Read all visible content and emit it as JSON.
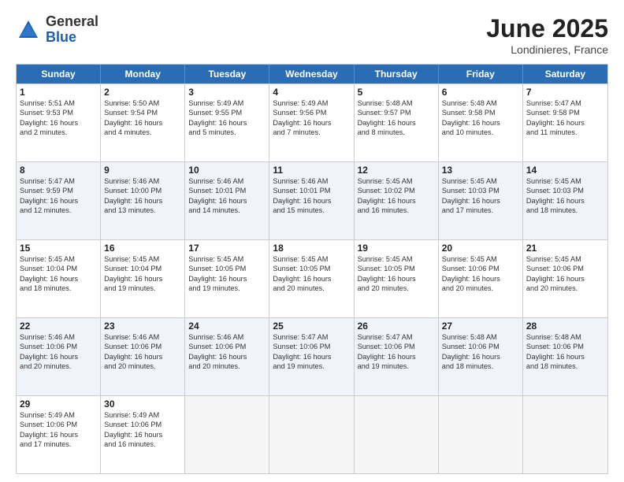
{
  "header": {
    "logo_general": "General",
    "logo_blue": "Blue",
    "title": "June 2025",
    "location": "Londinieres, France"
  },
  "days_of_week": [
    "Sunday",
    "Monday",
    "Tuesday",
    "Wednesday",
    "Thursday",
    "Friday",
    "Saturday"
  ],
  "rows": [
    [
      {
        "day": "1",
        "lines": [
          "Sunrise: 5:51 AM",
          "Sunset: 9:53 PM",
          "Daylight: 16 hours",
          "and 2 minutes."
        ]
      },
      {
        "day": "2",
        "lines": [
          "Sunrise: 5:50 AM",
          "Sunset: 9:54 PM",
          "Daylight: 16 hours",
          "and 4 minutes."
        ]
      },
      {
        "day": "3",
        "lines": [
          "Sunrise: 5:49 AM",
          "Sunset: 9:55 PM",
          "Daylight: 16 hours",
          "and 5 minutes."
        ]
      },
      {
        "day": "4",
        "lines": [
          "Sunrise: 5:49 AM",
          "Sunset: 9:56 PM",
          "Daylight: 16 hours",
          "and 7 minutes."
        ]
      },
      {
        "day": "5",
        "lines": [
          "Sunrise: 5:48 AM",
          "Sunset: 9:57 PM",
          "Daylight: 16 hours",
          "and 8 minutes."
        ]
      },
      {
        "day": "6",
        "lines": [
          "Sunrise: 5:48 AM",
          "Sunset: 9:58 PM",
          "Daylight: 16 hours",
          "and 10 minutes."
        ]
      },
      {
        "day": "7",
        "lines": [
          "Sunrise: 5:47 AM",
          "Sunset: 9:58 PM",
          "Daylight: 16 hours",
          "and 11 minutes."
        ]
      }
    ],
    [
      {
        "day": "8",
        "lines": [
          "Sunrise: 5:47 AM",
          "Sunset: 9:59 PM",
          "Daylight: 16 hours",
          "and 12 minutes."
        ]
      },
      {
        "day": "9",
        "lines": [
          "Sunrise: 5:46 AM",
          "Sunset: 10:00 PM",
          "Daylight: 16 hours",
          "and 13 minutes."
        ]
      },
      {
        "day": "10",
        "lines": [
          "Sunrise: 5:46 AM",
          "Sunset: 10:01 PM",
          "Daylight: 16 hours",
          "and 14 minutes."
        ]
      },
      {
        "day": "11",
        "lines": [
          "Sunrise: 5:46 AM",
          "Sunset: 10:01 PM",
          "Daylight: 16 hours",
          "and 15 minutes."
        ]
      },
      {
        "day": "12",
        "lines": [
          "Sunrise: 5:45 AM",
          "Sunset: 10:02 PM",
          "Daylight: 16 hours",
          "and 16 minutes."
        ]
      },
      {
        "day": "13",
        "lines": [
          "Sunrise: 5:45 AM",
          "Sunset: 10:03 PM",
          "Daylight: 16 hours",
          "and 17 minutes."
        ]
      },
      {
        "day": "14",
        "lines": [
          "Sunrise: 5:45 AM",
          "Sunset: 10:03 PM",
          "Daylight: 16 hours",
          "and 18 minutes."
        ]
      }
    ],
    [
      {
        "day": "15",
        "lines": [
          "Sunrise: 5:45 AM",
          "Sunset: 10:04 PM",
          "Daylight: 16 hours",
          "and 18 minutes."
        ]
      },
      {
        "day": "16",
        "lines": [
          "Sunrise: 5:45 AM",
          "Sunset: 10:04 PM",
          "Daylight: 16 hours",
          "and 19 minutes."
        ]
      },
      {
        "day": "17",
        "lines": [
          "Sunrise: 5:45 AM",
          "Sunset: 10:05 PM",
          "Daylight: 16 hours",
          "and 19 minutes."
        ]
      },
      {
        "day": "18",
        "lines": [
          "Sunrise: 5:45 AM",
          "Sunset: 10:05 PM",
          "Daylight: 16 hours",
          "and 20 minutes."
        ]
      },
      {
        "day": "19",
        "lines": [
          "Sunrise: 5:45 AM",
          "Sunset: 10:05 PM",
          "Daylight: 16 hours",
          "and 20 minutes."
        ]
      },
      {
        "day": "20",
        "lines": [
          "Sunrise: 5:45 AM",
          "Sunset: 10:06 PM",
          "Daylight: 16 hours",
          "and 20 minutes."
        ]
      },
      {
        "day": "21",
        "lines": [
          "Sunrise: 5:45 AM",
          "Sunset: 10:06 PM",
          "Daylight: 16 hours",
          "and 20 minutes."
        ]
      }
    ],
    [
      {
        "day": "22",
        "lines": [
          "Sunrise: 5:46 AM",
          "Sunset: 10:06 PM",
          "Daylight: 16 hours",
          "and 20 minutes."
        ]
      },
      {
        "day": "23",
        "lines": [
          "Sunrise: 5:46 AM",
          "Sunset: 10:06 PM",
          "Daylight: 16 hours",
          "and 20 minutes."
        ]
      },
      {
        "day": "24",
        "lines": [
          "Sunrise: 5:46 AM",
          "Sunset: 10:06 PM",
          "Daylight: 16 hours",
          "and 20 minutes."
        ]
      },
      {
        "day": "25",
        "lines": [
          "Sunrise: 5:47 AM",
          "Sunset: 10:06 PM",
          "Daylight: 16 hours",
          "and 19 minutes."
        ]
      },
      {
        "day": "26",
        "lines": [
          "Sunrise: 5:47 AM",
          "Sunset: 10:06 PM",
          "Daylight: 16 hours",
          "and 19 minutes."
        ]
      },
      {
        "day": "27",
        "lines": [
          "Sunrise: 5:48 AM",
          "Sunset: 10:06 PM",
          "Daylight: 16 hours",
          "and 18 minutes."
        ]
      },
      {
        "day": "28",
        "lines": [
          "Sunrise: 5:48 AM",
          "Sunset: 10:06 PM",
          "Daylight: 16 hours",
          "and 18 minutes."
        ]
      }
    ],
    [
      {
        "day": "29",
        "lines": [
          "Sunrise: 5:49 AM",
          "Sunset: 10:06 PM",
          "Daylight: 16 hours",
          "and 17 minutes."
        ]
      },
      {
        "day": "30",
        "lines": [
          "Sunrise: 5:49 AM",
          "Sunset: 10:06 PM",
          "Daylight: 16 hours",
          "and 16 minutes."
        ]
      },
      {
        "day": "",
        "lines": []
      },
      {
        "day": "",
        "lines": []
      },
      {
        "day": "",
        "lines": []
      },
      {
        "day": "",
        "lines": []
      },
      {
        "day": "",
        "lines": []
      }
    ]
  ],
  "alt_rows": [
    1,
    3
  ]
}
